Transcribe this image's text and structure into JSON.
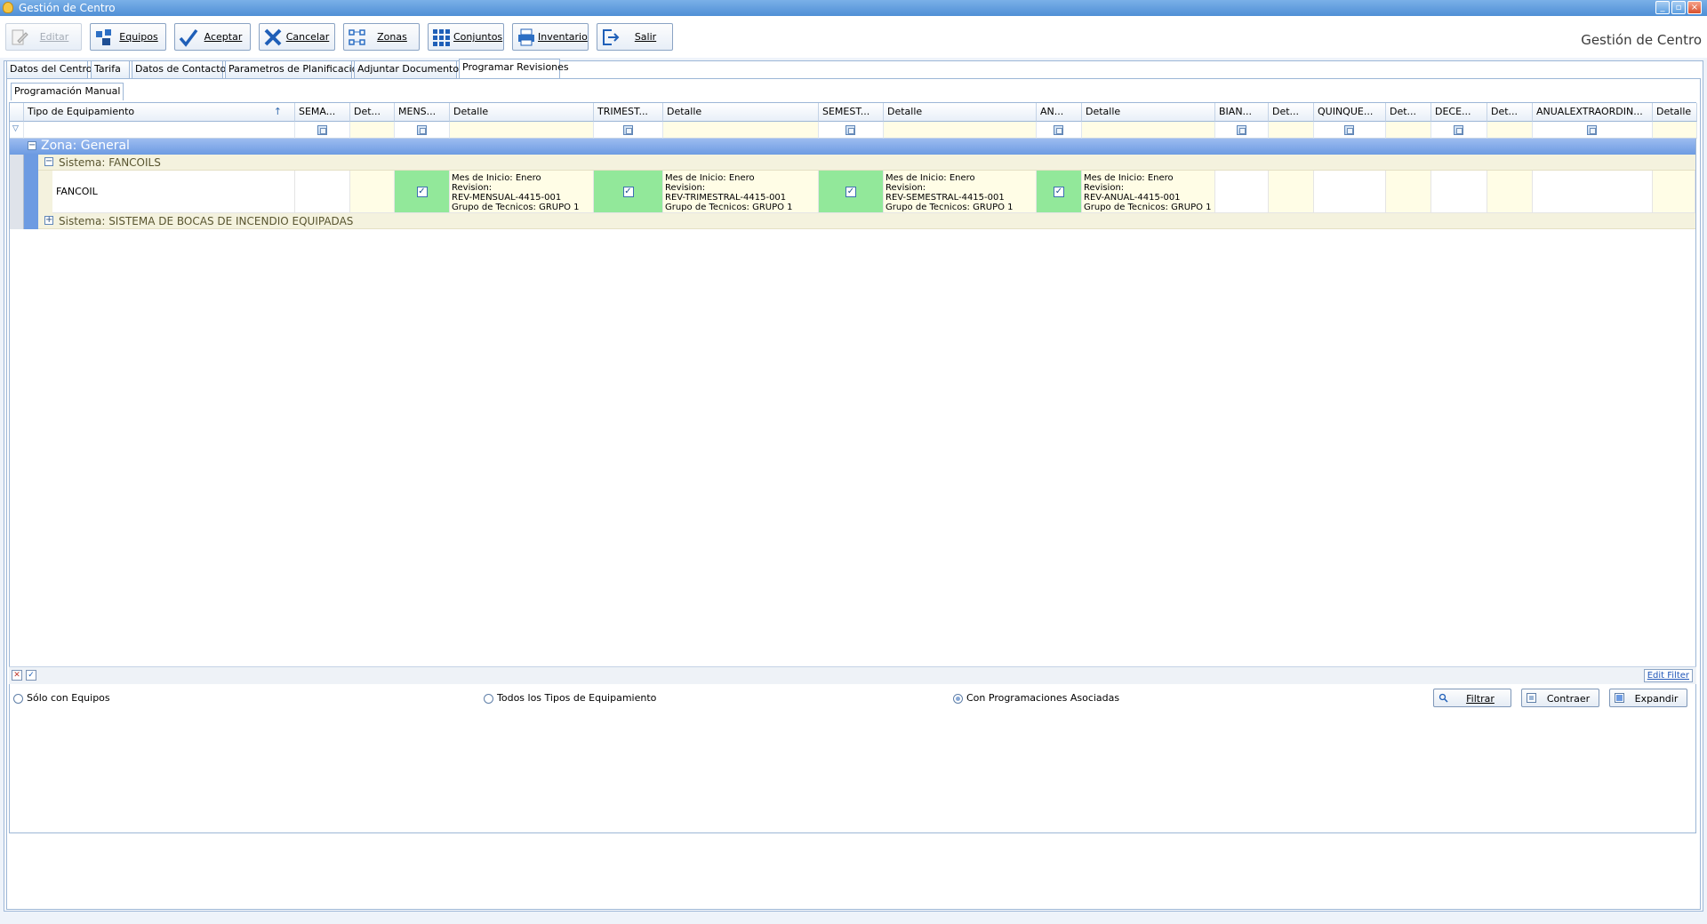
{
  "window": {
    "title": "Gestión de Centro"
  },
  "app_title": "Gestión de Centro",
  "toolbar": {
    "editar": "Editar",
    "equipos": "Equipos",
    "aceptar": "Aceptar",
    "cancelar": "Cancelar",
    "zonas": "Zonas",
    "conjuntos": "Conjuntos",
    "inventario": "Inventario",
    "salir": "Salir"
  },
  "tabs": [
    "Datos del Centro",
    "Tarifa",
    "Datos de Contactos",
    "Parametros de Planificación",
    "Adjuntar Documentos",
    "Programar Revisiones"
  ],
  "active_tab": "Programar Revisiones",
  "subtab": "Programación Manual",
  "columns": [
    "Tipo de Equipamiento",
    "SEMA...",
    "Det...",
    "MENS...",
    "Detalle",
    "TRIMEST...",
    "Detalle",
    "SEMEST...",
    "Detalle",
    "AN...",
    "Detalle",
    "BIAN...",
    "Det...",
    "QUINQUE...",
    "Det...",
    "DECE...",
    "Det...",
    "ANUALEXTRAORDIN...",
    "Detalle"
  ],
  "groups": {
    "zone": "Zona: General",
    "system1": "Sistema: FANCOILS",
    "system2": "Sistema: SISTEMA DE BOCAS DE INCENDIO EQUIPADAS"
  },
  "row": {
    "equipment": "FANCOIL",
    "mensual": [
      "Mes de Inicio: Enero",
      "Revision:",
      "REV-MENSUAL-4415-001",
      "Grupo de Tecnicos: GRUPO 1"
    ],
    "trimestral": [
      "Mes de Inicio: Enero",
      "Revision:",
      "REV-TRIMESTRAL-4415-001",
      "Grupo de Tecnicos: GRUPO 1"
    ],
    "semestral": [
      "Mes de Inicio: Enero",
      "Revision:",
      "REV-SEMESTRAL-4415-001",
      "Grupo de Tecnicos: GRUPO 1"
    ],
    "anual": [
      "Mes de Inicio: Enero",
      "Revision:",
      "REV-ANUAL-4415-001",
      "Grupo de Tecnicos: GRUPO 1"
    ]
  },
  "footer": {
    "edit_filter": "Edit Filter"
  },
  "options": {
    "solo_equipos": "Sólo con Equipos",
    "todos": "Todos los Tipos de Equipamiento",
    "con_prog": "Con Programaciones Asociadas",
    "selected": "Con Programaciones Asociadas"
  },
  "buttons": {
    "filtrar": "Filtrar",
    "contraer": "Contraer",
    "expandir": "Expandir"
  },
  "colors": {
    "checked_cell": "#92e89a",
    "detail_cell": "#fffde6",
    "zone_band": "#6d9be2"
  }
}
